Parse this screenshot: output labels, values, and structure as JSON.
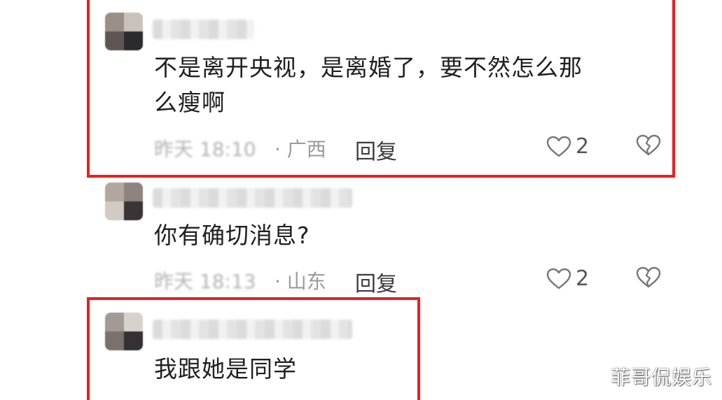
{
  "comments": [
    {
      "text_line1": "不是离开央视，是离婚了，要不然怎么那",
      "text_line2": "么瘦啊",
      "time": "昨天 18:10",
      "location": "· 广西",
      "reply_label": "回复",
      "likes": "2"
    },
    {
      "text_line1": "你有确切消息?",
      "time": "昨天 18:13",
      "location": "· 山东",
      "reply_label": "回复",
      "likes": "2"
    },
    {
      "text_line1": "我跟她是同学"
    }
  ],
  "icons": {
    "like": "heart-outline-icon",
    "dislike": "broken-heart-icon"
  },
  "colors": {
    "highlight_frame": "#e8201e",
    "text": "#1f1f1f",
    "meta": "#a0a0a0"
  },
  "watermark": "菲哥侃娱乐"
}
